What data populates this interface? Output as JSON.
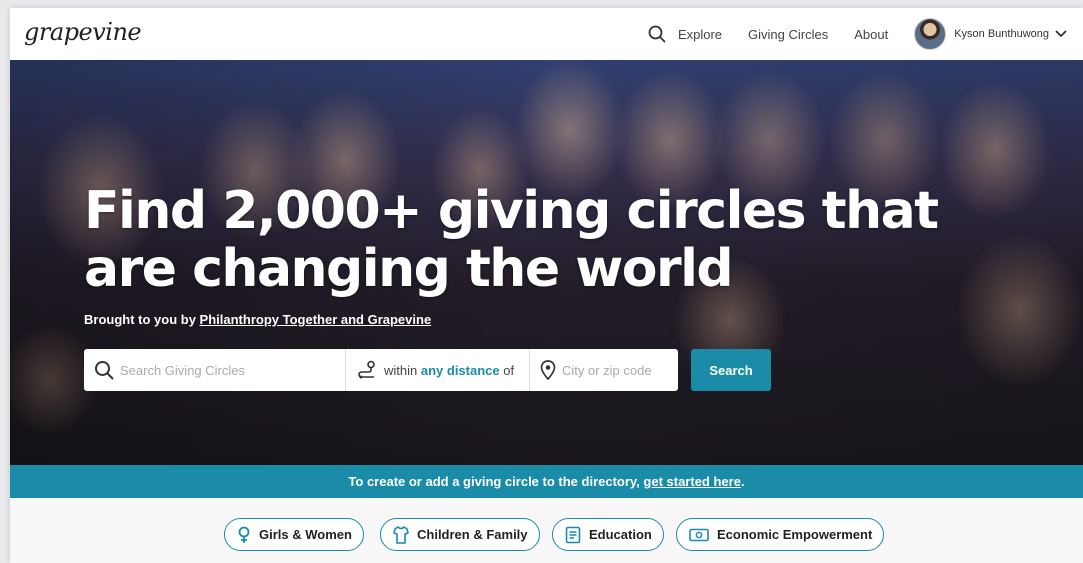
{
  "header": {
    "logo": "grapevine",
    "nav": [
      {
        "label": "Explore"
      },
      {
        "label": "Giving Circles"
      },
      {
        "label": "About"
      }
    ],
    "user_name": "Kyson Bunthuwong"
  },
  "hero": {
    "title": "Find 2,000+ giving circles that are changing the world",
    "subtitle_prefix": "Brought to you by ",
    "subtitle_link": "Philanthropy Together and Grapevine",
    "search": {
      "query_placeholder": "Search Giving Circles",
      "distance_prefix": "within ",
      "distance_value": "any distance",
      "distance_suffix": " of",
      "location_placeholder": "City or zip code",
      "button_label": "Search"
    }
  },
  "banner": {
    "text_prefix": "To create or add a giving circle to the directory, ",
    "link": "get started here",
    "text_suffix": "."
  },
  "categories": [
    {
      "label": "Girls & Women",
      "icon": "female-icon"
    },
    {
      "label": "Children & Family",
      "icon": "shirt-icon"
    },
    {
      "label": "Education",
      "icon": "book-icon"
    },
    {
      "label": "Economic Empowerment",
      "icon": "money-icon"
    }
  ],
  "colors": {
    "accent": "#1a8ca8",
    "banner": "#1a8ca8"
  }
}
